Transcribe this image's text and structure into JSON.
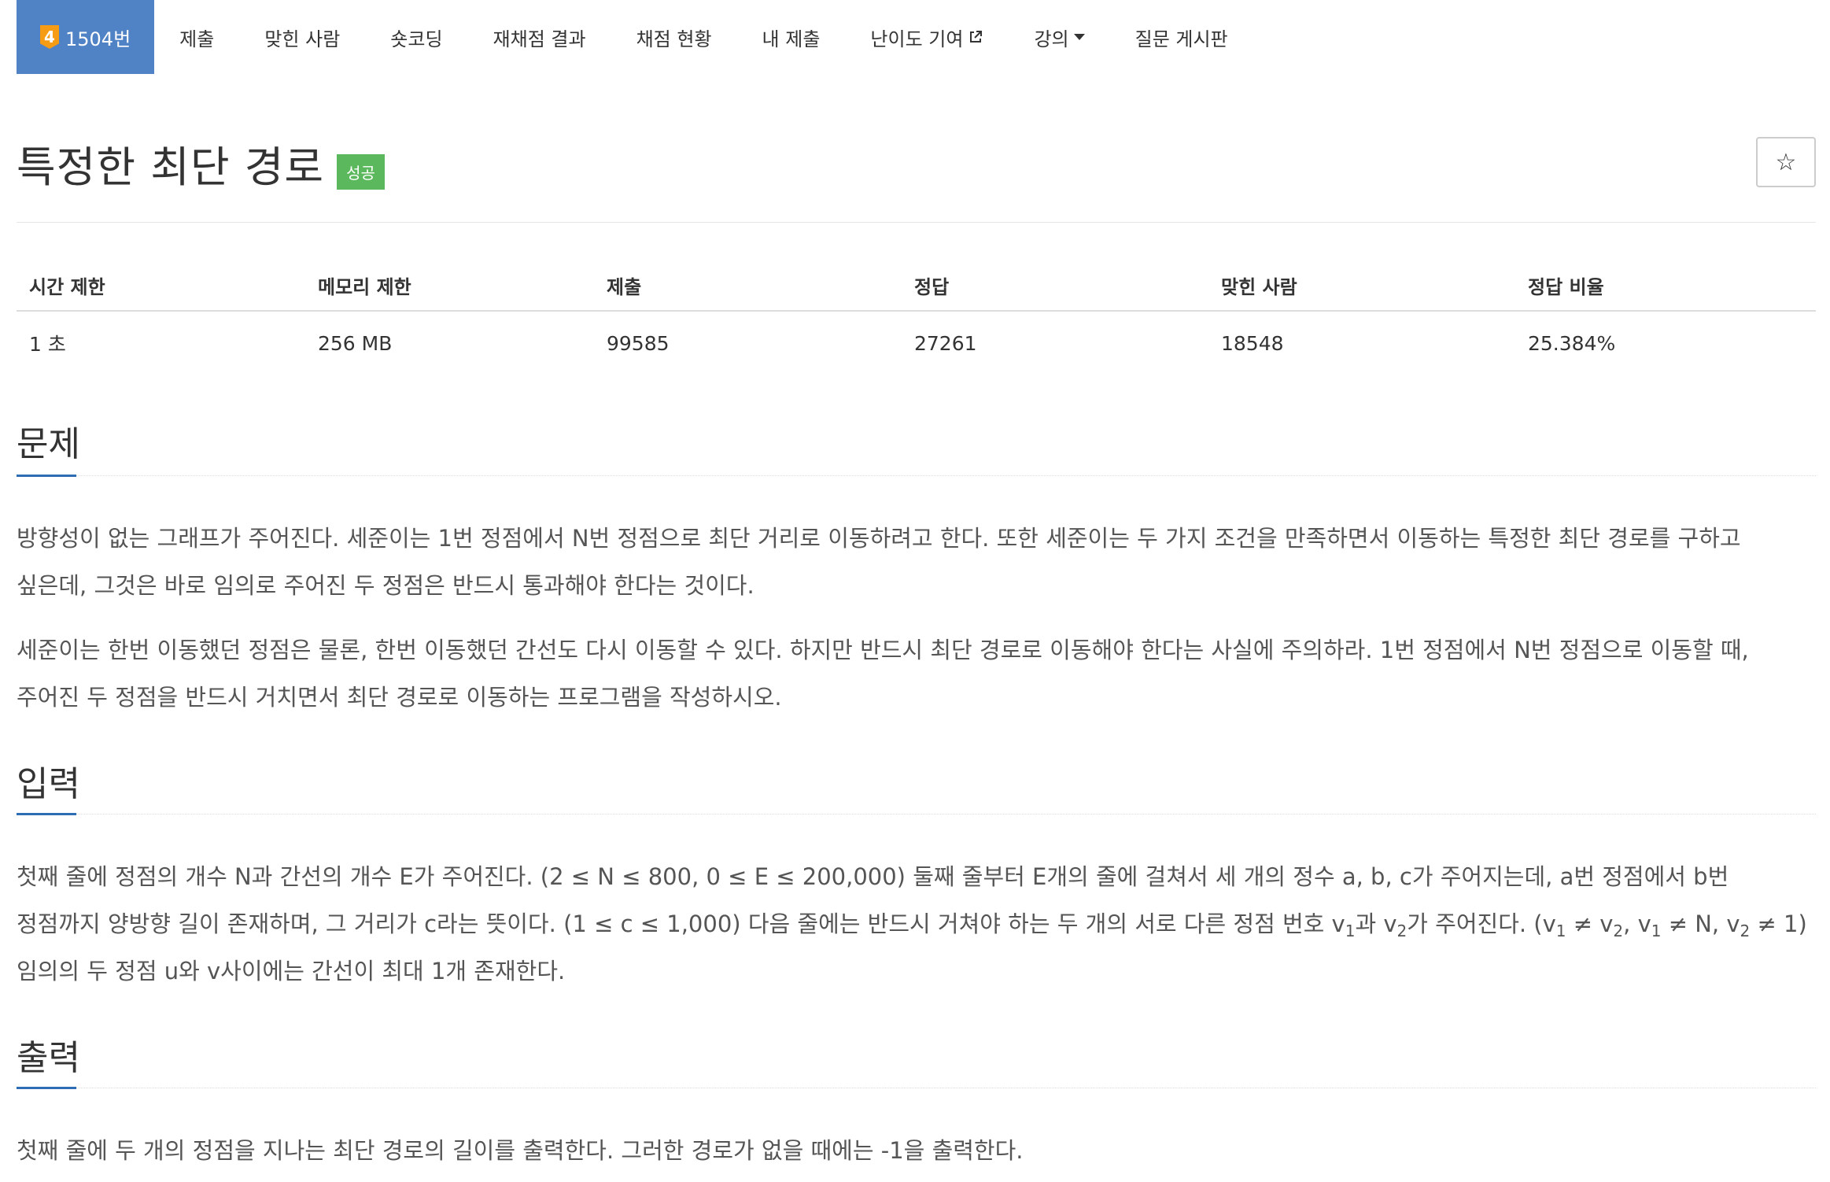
{
  "nav": {
    "problem_number": "1504번",
    "tier_badge": "4",
    "items": [
      "제출",
      "맞힌 사람",
      "숏코딩",
      "재채점 결과",
      "채점 현황",
      "내 제출",
      "난이도 기여",
      "강의",
      "질문 게시판"
    ],
    "active_color": "#5083c5"
  },
  "title": "특정한 최단 경로",
  "status_badge": "성공",
  "star_button": "☆",
  "stats": {
    "headers": [
      "시간 제한",
      "메모리 제한",
      "제출",
      "정답",
      "맞힌 사람",
      "정답 비율"
    ],
    "values": [
      "1 초",
      "256 MB",
      "99585",
      "27261",
      "18548",
      "25.384%"
    ]
  },
  "sections": {
    "problem": {
      "title": "문제",
      "p1": "방향성이 없는 그래프가 주어진다. 세준이는 1번 정점에서 N번 정점으로 최단 거리로 이동하려고 한다. 또한 세준이는 두 가지 조건을 만족하면서 이동하는 특정한 최단 경로를 구하고 싶은데, 그것은 바로 임의로 주어진 두 정점은 반드시 통과해야 한다는 것이다.",
      "p2": "세준이는 한번 이동했던 정점은 물론, 한번 이동했던 간선도 다시 이동할 수 있다. 하지만 반드시 최단 경로로 이동해야 한다는 사실에 주의하라. 1번 정점에서 N번 정점으로 이동할 때, 주어진 두 정점을 반드시 거치면서 최단 경로로 이동하는 프로그램을 작성하시오."
    },
    "input": {
      "title": "입력",
      "t1": "첫째 줄에 정점의 개수 N과 간선의 개수 E가 주어진다. (2 ≤ N ≤ 800, 0 ≤ E ≤ 200,000) 둘째 줄부터 E개의 줄에 걸쳐서 세 개의 정수 a, b, c가 주어지는데, a번 정점에서 b번 정점까지 양방향 길이 존재하며, 그 거리가 c라는 뜻이다. (1 ≤ c ≤ 1,000) 다음 줄에는 반드시 거쳐야 하는 두 개의 서로 다른 정점 번호 v",
      "s1": "1",
      "t2": "과 v",
      "s2": "2",
      "t3": "가 주어진다. (v",
      "s3": "1",
      "t4": " ≠ v",
      "s4": "2",
      "t5": ", v",
      "s5": "1",
      "t6": " ≠ N, v",
      "s6": "2",
      "t7": " ≠ 1) 임의의 두 정점 u와 v사이에는 간선이 최대 1개 존재한다."
    },
    "output": {
      "title": "출력",
      "p1": "첫째 줄에 두 개의 정점을 지나는 최단 경로의 길이를 출력한다. 그러한 경로가 없을 때에는 -1을 출력한다."
    }
  }
}
